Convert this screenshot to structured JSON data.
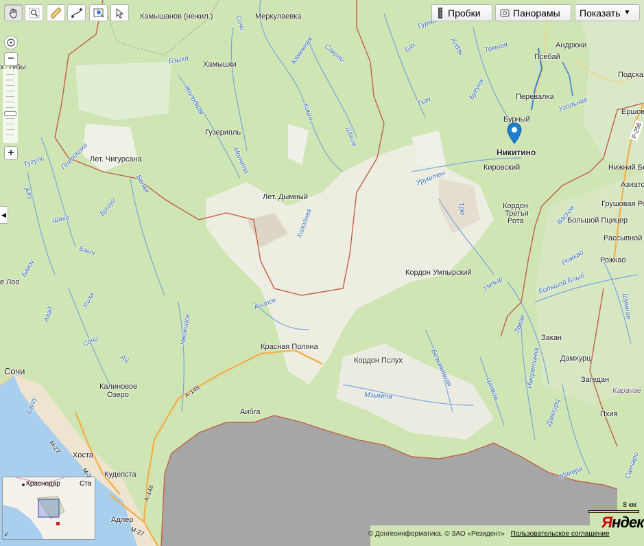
{
  "toolbar": {
    "tools": [
      {
        "name": "hand-tool",
        "icon": "hand-icon"
      },
      {
        "name": "zoom-area-tool",
        "icon": "magnifier-icon"
      },
      {
        "name": "ruler-tool",
        "icon": "ruler-icon"
      },
      {
        "name": "route-tool",
        "icon": "route-icon"
      },
      {
        "name": "add-object-tool",
        "icon": "map-pin-plus-icon"
      },
      {
        "name": "select-tool",
        "icon": "cursor-icon"
      }
    ],
    "traffic_label": "Пробки",
    "panoramas_label": "Панорамы",
    "show_label": "Показать",
    "show_arrow": "▼"
  },
  "zoom": {
    "plus": "+",
    "minus": "−",
    "level_fraction": 0.6
  },
  "marker": {
    "label": "Никитино",
    "color": "#1e7fd0"
  },
  "places": [
    {
      "id": "kamyshanov",
      "text": "Камышанов (нежил.)"
    },
    {
      "id": "merkulaevka",
      "text": "Меркулаевка"
    },
    {
      "id": "andryuki",
      "text": "Андрюки"
    },
    {
      "id": "psebai",
      "text": "Псебай"
    },
    {
      "id": "podskal",
      "text": "Подскал"
    },
    {
      "id": "perevalka",
      "text": "Перевалка"
    },
    {
      "id": "ershov",
      "text": "Ершов"
    },
    {
      "id": "khamyshki",
      "text": "Хамышки"
    },
    {
      "id": "tuby",
      "text": "х. Тубы"
    },
    {
      "id": "burny",
      "text": "Бурный"
    },
    {
      "id": "guzeripl",
      "text": "Гузерипль"
    },
    {
      "id": "chigursana",
      "text": "Лет. Чигурсана"
    },
    {
      "id": "kirovsky",
      "text": "Кировский"
    },
    {
      "id": "nizhny",
      "text": "Нижний Бе"
    },
    {
      "id": "aziat",
      "text": "Азиатс"
    },
    {
      "id": "dymny",
      "text": "Лет. Дымный"
    },
    {
      "id": "grushovaya",
      "text": "Грушовая Рота"
    },
    {
      "id": "kordon3",
      "text": "Кордон"
    },
    {
      "id": "kordon3b",
      "text": "Третья"
    },
    {
      "id": "kordon3c",
      "text": "Рота"
    },
    {
      "id": "pitsyr",
      "text": "Большой Пцицер"
    },
    {
      "id": "rassypnoy",
      "text": "Рассыпной"
    },
    {
      "id": "rozhkao",
      "text": "Рожкао"
    },
    {
      "id": "loo",
      "text": "е Лоо"
    },
    {
      "id": "umpyr",
      "text": "Кордон Умпырский"
    },
    {
      "id": "zakan",
      "text": "Закан"
    },
    {
      "id": "krpolyana",
      "text": "Красная Поляна"
    },
    {
      "id": "pslukh",
      "text": "Кордон Пслух"
    },
    {
      "id": "damkhurts",
      "text": "Дамхурц"
    },
    {
      "id": "sochi",
      "text": "Сочи"
    },
    {
      "id": "zageden",
      "text": "Загедан"
    },
    {
      "id": "kalinovoe",
      "text": "Калиновое"
    },
    {
      "id": "kalinovoe2",
      "text": "Озеро"
    },
    {
      "id": "karachae",
      "text": "Карачае"
    },
    {
      "id": "aibga",
      "text": "Аибга"
    },
    {
      "id": "pkhiya",
      "text": "Пхия"
    },
    {
      "id": "khosta",
      "text": "Хоста"
    },
    {
      "id": "kudepsta",
      "text": "Кудепста"
    },
    {
      "id": "adler",
      "text": "Адлер"
    }
  ],
  "roads": [
    {
      "id": "r256",
      "text": "Р-256"
    },
    {
      "id": "a148",
      "text": "А-148"
    },
    {
      "id": "a148b",
      "text": "А-148"
    },
    {
      "id": "m27",
      "text": "М-27"
    },
    {
      "id": "m27b",
      "text": "М-27"
    },
    {
      "id": "m27c",
      "text": "М-27"
    }
  ],
  "rivers": [
    {
      "id": "sochi_r",
      "text": "Сочи"
    },
    {
      "id": "gurman",
      "text": "Гурман"
    },
    {
      "id": "kamennaya",
      "text": "Каменная"
    },
    {
      "id": "sakhrai",
      "text": "Сахрай"
    },
    {
      "id": "bakh",
      "text": "Бах"
    },
    {
      "id": "khodz",
      "text": "Ходзь"
    },
    {
      "id": "temnaya",
      "text": "Темная"
    },
    {
      "id": "bzykha",
      "text": "Бзыха"
    },
    {
      "id": "zholobnaya",
      "text": "Жолобная"
    },
    {
      "id": "kisha",
      "text": "Киша"
    },
    {
      "id": "shisha",
      "text": "Шиша"
    },
    {
      "id": "tkhach",
      "text": "Тхач"
    },
    {
      "id": "bugunzh",
      "text": "Бугунж"
    },
    {
      "id": "ugolnaya",
      "text": "Угольная"
    },
    {
      "id": "pshekhashkha",
      "text": "Пшехашха"
    },
    {
      "id": "tugups",
      "text": "Тугупс"
    },
    {
      "id": "molchepa",
      "text": "Молчепа"
    },
    {
      "id": "urushten",
      "text": "Уруштен"
    },
    {
      "id": "belaya",
      "text": "Белая"
    },
    {
      "id": "azhu",
      "text": "Ажу"
    },
    {
      "id": "shakhe",
      "text": "Шахе"
    },
    {
      "id": "bushuy",
      "text": "Бушуй"
    },
    {
      "id": "kholodnaya",
      "text": "Холодная"
    },
    {
      "id": "trio",
      "text": "Трю"
    },
    {
      "id": "baskov",
      "text": "Васков"
    },
    {
      "id": "rozhkao_r",
      "text": "Рожкао"
    },
    {
      "id": "bezymyannaya",
      "text": "Безымянная"
    },
    {
      "id": "bolshoy_blyb",
      "text": "Большой Блыб"
    },
    {
      "id": "shumnaya",
      "text": "Шумная"
    },
    {
      "id": "umpyr_r",
      "text": "Умпыр"
    },
    {
      "id": "bzych",
      "text": "Бзыч"
    },
    {
      "id": "bagou",
      "text": "Багоу"
    },
    {
      "id": "achipse",
      "text": "Ачипсе"
    },
    {
      "id": "ushkha",
      "text": "Ушха"
    },
    {
      "id": "avad",
      "text": "Авад"
    },
    {
      "id": "chvezhipse",
      "text": "Чвежипсе"
    },
    {
      "id": "sochi_r2",
      "text": "Сочи"
    },
    {
      "id": "ats",
      "text": "Ац"
    },
    {
      "id": "zakan_r",
      "text": "Закан"
    },
    {
      "id": "imeretinka",
      "text": "Имеретинка"
    },
    {
      "id": "tsakhvoa",
      "text": "Цахвоа"
    },
    {
      "id": "mzymta",
      "text": "Мзымта"
    },
    {
      "id": "damkhurts_r",
      "text": "Дамхурц"
    },
    {
      "id": "bzuguzhu",
      "text": "Бзугу"
    },
    {
      "id": "makera",
      "text": "Макера"
    },
    {
      "id": "sancharo",
      "text": "Санчаро"
    }
  ],
  "minimap": {
    "krasnodar": "Краснодар",
    "stavropol": "Ста"
  },
  "scale": {
    "label": "8 км"
  },
  "logo": {
    "first": "Я",
    "rest": "ндекс"
  },
  "copyright": {
    "text": "© Донгеоинформатика, © ЗАО «Резидент»",
    "link": "Пользовательское соглашение"
  },
  "colors": {
    "forest": "#c6e0a7",
    "snow": "#f3f1ec",
    "sea": "#9b9b9b",
    "coast": "#9ec3e8",
    "river": "#6b9ad6",
    "border": "#b4513e",
    "highway": "#f4b355"
  }
}
